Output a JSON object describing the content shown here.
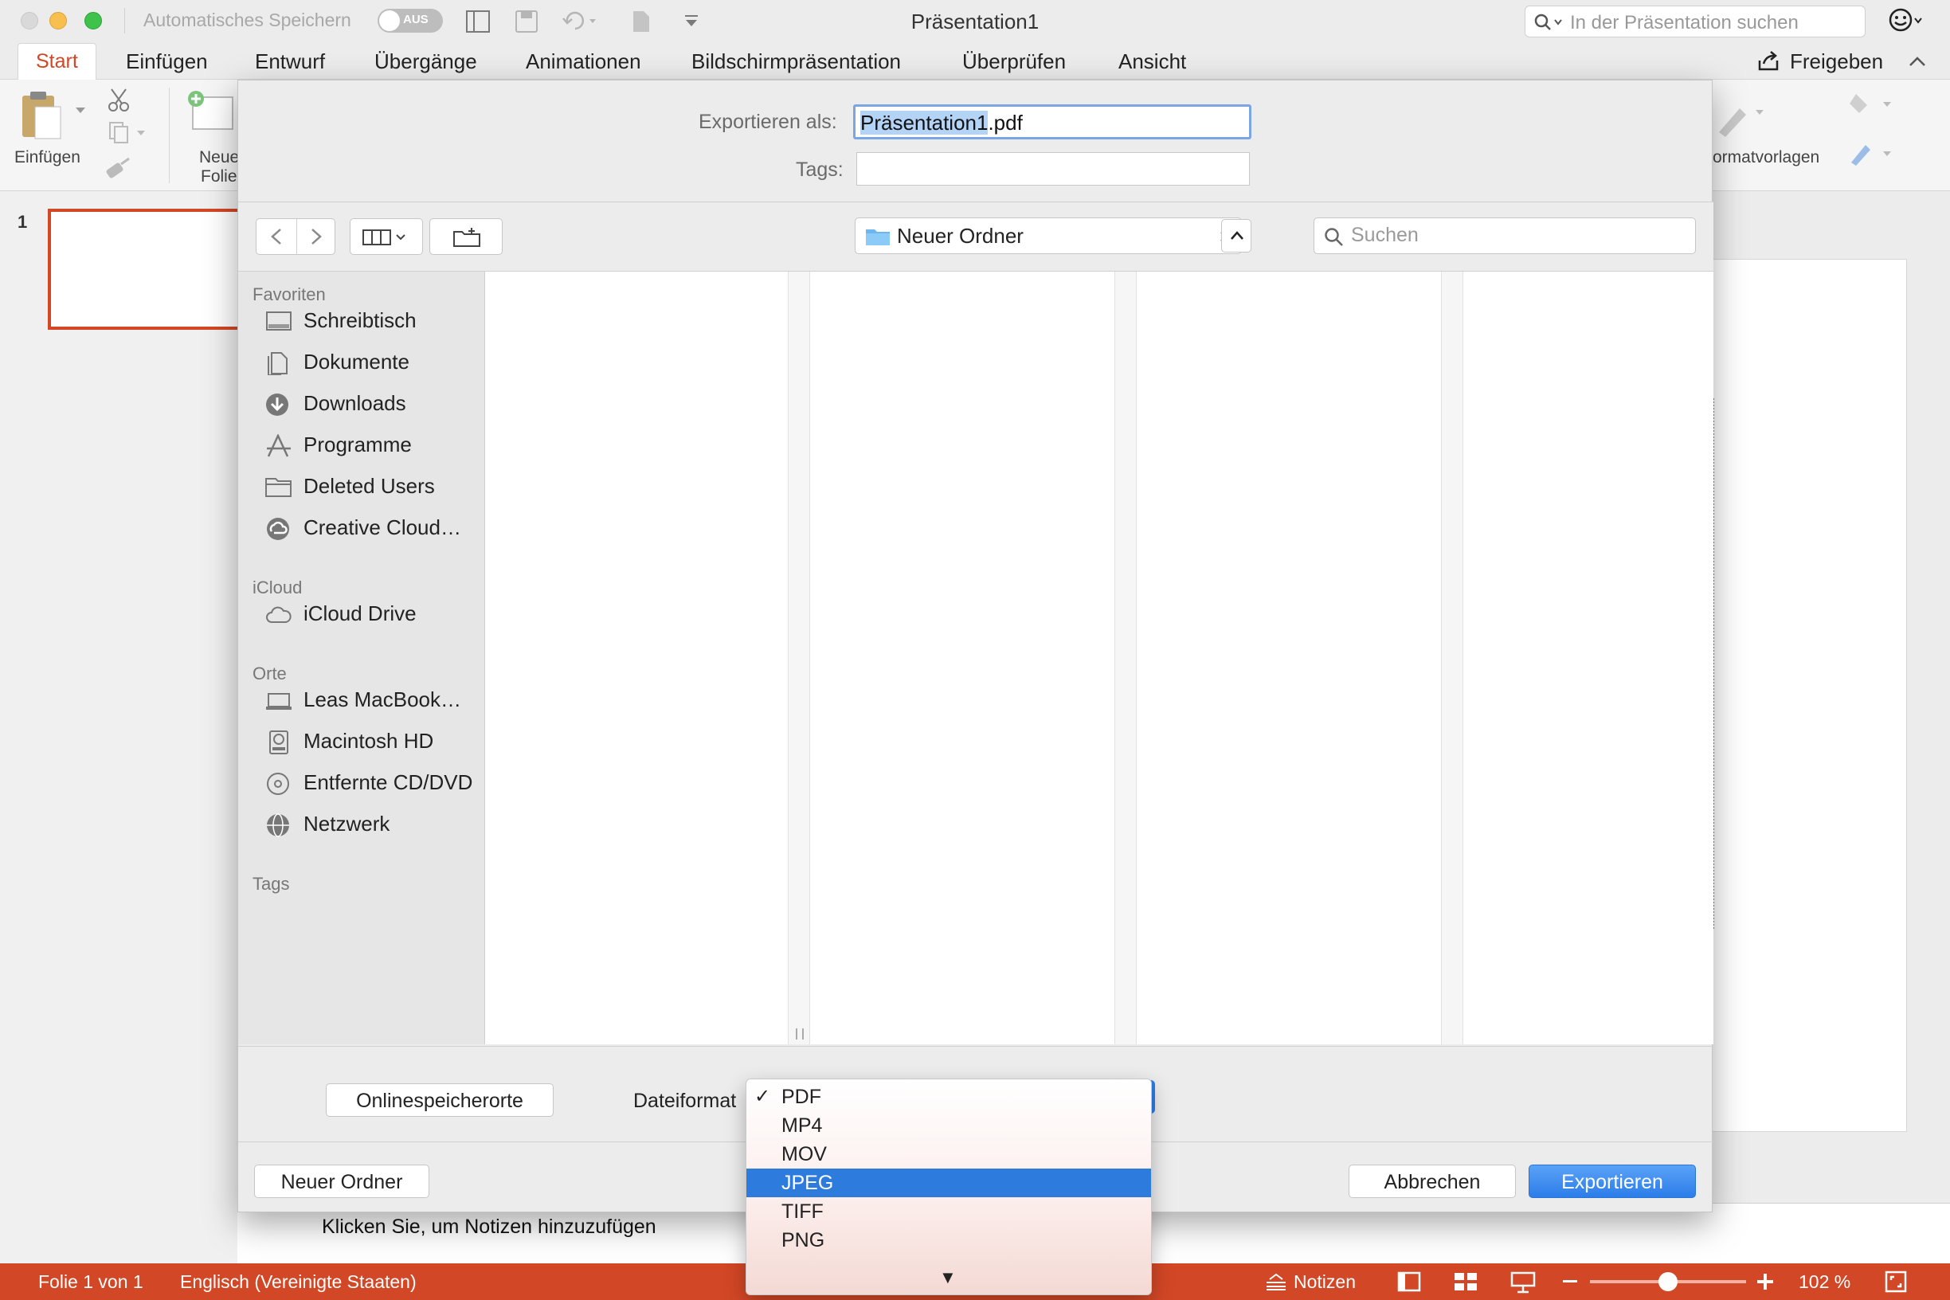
{
  "titlebar": {
    "autosave_label": "Automatisches Speichern",
    "autosave_state": "AUS",
    "document_title": "Präsentation1",
    "search_placeholder": "In der Präsentation suchen"
  },
  "ribbon": {
    "tabs": [
      "Start",
      "Einfügen",
      "Entwurf",
      "Übergänge",
      "Animationen",
      "Bildschirmpräsentation",
      "Überprüfen",
      "Ansicht"
    ],
    "active_tab": "Start",
    "share_label": "Freigeben",
    "paste_label": "Einfügen",
    "new_slide_label_1": "Neue",
    "new_slide_label_2": "Folie",
    "styles_label": "ormatvorlagen"
  },
  "slides_panel": {
    "slide_number": "1"
  },
  "dialog": {
    "export_as_label": "Exportieren als:",
    "filename_selected": "Präsentation1",
    "filename_ext": ".pdf",
    "tags_label": "Tags:",
    "location": "Neuer Ordner",
    "search_placeholder": "Suchen",
    "sidebar": {
      "favorites_header": "Favoriten",
      "favorites": [
        {
          "label": "Schreibtisch",
          "icon": "desktop-icon"
        },
        {
          "label": "Dokumente",
          "icon": "documents-icon"
        },
        {
          "label": "Downloads",
          "icon": "downloads-icon"
        },
        {
          "label": "Programme",
          "icon": "applications-icon"
        },
        {
          "label": "Deleted Users",
          "icon": "folder-icon"
        },
        {
          "label": "Creative Cloud…",
          "icon": "creative-cloud-icon"
        }
      ],
      "icloud_header": "iCloud",
      "icloud": [
        {
          "label": "iCloud Drive",
          "icon": "cloud-icon"
        }
      ],
      "places_header": "Orte",
      "places": [
        {
          "label": "Leas MacBook…",
          "icon": "laptop-icon"
        },
        {
          "label": "Macintosh HD",
          "icon": "hard-drive-icon"
        },
        {
          "label": "Entfernte CD/DVD",
          "icon": "disc-icon"
        },
        {
          "label": "Netzwerk",
          "icon": "network-icon"
        }
      ],
      "tags_header": "Tags"
    },
    "online_locations_button": "Onlinespeicherorte",
    "file_format_label": "Dateiformat",
    "new_folder_button": "Neuer Ordner",
    "cancel_button": "Abbrechen",
    "export_button": "Exportieren"
  },
  "format_menu": {
    "items": [
      "PDF",
      "MP4",
      "MOV",
      "JPEG",
      "TIFF",
      "PNG"
    ],
    "checked": "PDF",
    "highlighted": "JPEG",
    "more_indicator": "▼"
  },
  "notes": {
    "placeholder": "Klicken Sie, um Notizen hinzuzufügen"
  },
  "statusbar": {
    "slide_info": "Folie 1 von 1",
    "language": "Englisch (Vereinigte Staaten)",
    "notes_label": "Notizen",
    "zoom_level": "102 %",
    "zoom_fraction": 0.5
  },
  "colors": {
    "accent": "#d24726",
    "selection": "#2e7bde"
  }
}
